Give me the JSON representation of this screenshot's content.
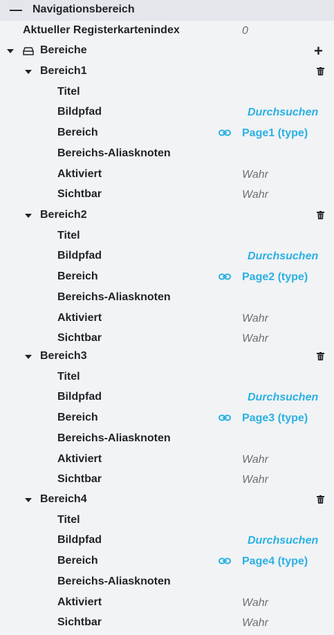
{
  "header": {
    "title": "Navigationsbereich"
  },
  "current_index": {
    "label": "Aktueller Registerkartenindex",
    "value": "0"
  },
  "areas": {
    "label": "Bereiche",
    "add_icon": "+"
  },
  "sections": [
    {
      "name": "Bereich1",
      "props": {
        "title": "Titel",
        "image_path": "Bildpfad",
        "image_action": "Durchsuchen",
        "area": "Bereich",
        "area_value": "Page1 (type)",
        "alias": "Bereichs-Aliasknoten",
        "enabled": "Aktiviert",
        "enabled_value": "Wahr",
        "visible": "Sichtbar",
        "visible_value": "Wahr"
      }
    },
    {
      "name": "Bereich2",
      "props": {
        "title": "Titel",
        "image_path": "Bildpfad",
        "image_action": "Durchsuchen",
        "area": "Bereich",
        "area_value": "Page2 (type)",
        "alias": "Bereichs-Aliasknoten",
        "enabled": "Aktiviert",
        "enabled_value": "Wahr",
        "visible": "Sichtbar",
        "visible_value": "Wahr"
      }
    },
    {
      "name": "Bereich3",
      "props": {
        "title": "Titel",
        "image_path": "Bildpfad",
        "image_action": "Durchsuchen",
        "area": "Bereich",
        "area_value": "Page3 (type)",
        "alias": "Bereichs-Aliasknoten",
        "enabled": "Aktiviert",
        "enabled_value": "Wahr",
        "visible": "Sichtbar",
        "visible_value": "Wahr"
      }
    },
    {
      "name": "Bereich4",
      "props": {
        "title": "Titel",
        "image_path": "Bildpfad",
        "image_action": "Durchsuchen",
        "area": "Bereich",
        "area_value": "Page4 (type)",
        "alias": "Bereichs-Aliasknoten",
        "enabled": "Aktiviert",
        "enabled_value": "Wahr",
        "visible": "Sichtbar",
        "visible_value": "Wahr"
      }
    }
  ],
  "colors": {
    "accent": "#2ab0e4",
    "background": "#f1f3f5",
    "header": "#e3e6ea",
    "muted": "#6b6f75"
  },
  "icons": {
    "collapse": "minus-icon",
    "expand": "caret-down-icon",
    "add": "plus-icon",
    "delete": "trash-icon",
    "reference": "link-icon",
    "group": "drive-icon"
  }
}
